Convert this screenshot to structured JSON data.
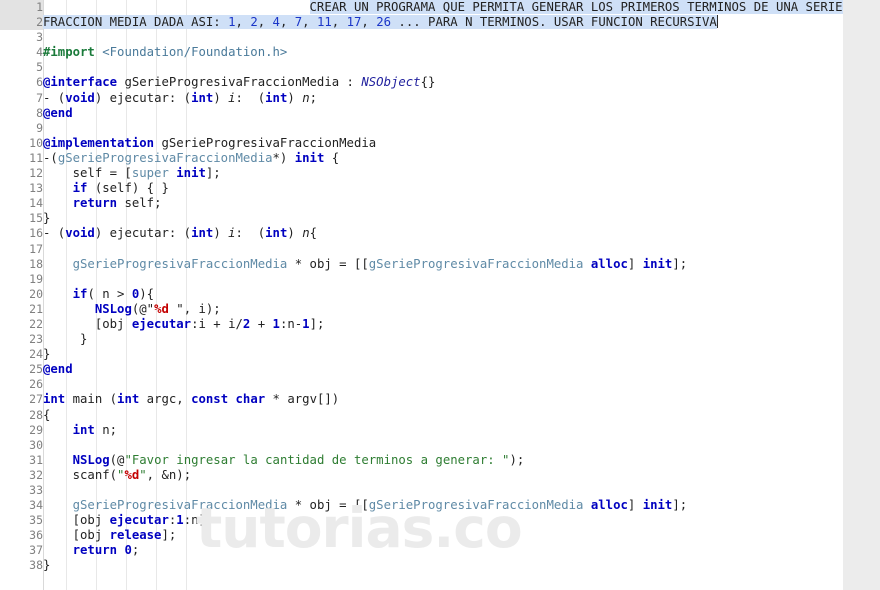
{
  "editor": {
    "language": "Objective-C",
    "watermark": "tutorias.co",
    "total_lines": 38,
    "selection_text_line1": "CREAR UN PROGRAMA QUE PERMITA GENERAR LOS PRIMEROS TERMINOS DE UNA SERIE PROGRESIVA",
    "selection_text_line2": "FRACCION MEDIA DADA ASI: 1, 2, 4, 7, 11, 17, 26 ... PARA N TERMINOS. USAR FUNCION RECURSIVA",
    "colors": {
      "background": "#ffffff",
      "gutter_text": "#808080",
      "gutter_selected_bg": "#e3e3e3",
      "selection_bg": "#cfe0f7",
      "keyword": "#0000c0",
      "preprocessor": "#1a7a3a",
      "class_name": "#5f8aa6",
      "string": "#2e7d32",
      "format_specifier": "#c40000",
      "number": "#0000c0",
      "scrollbar_track": "#ececec"
    }
  },
  "line_numbers": [
    1,
    2,
    3,
    4,
    5,
    6,
    7,
    8,
    9,
    10,
    11,
    12,
    13,
    14,
    15,
    16,
    17,
    18,
    19,
    20,
    21,
    22,
    23,
    24,
    25,
    26,
    27,
    28,
    29,
    30,
    31,
    32,
    33,
    34,
    35,
    36,
    37,
    38
  ],
  "code_lines": {
    "l1": "                                    CREAR UN PROGRAMA QUE PERMITA GENERAR LOS PRIMEROS TERMINOS DE UNA SERIE PROGRESIVA",
    "l2": "FRACCION MEDIA DADA ASI: 1, 2, 4, 7, 11, 17, 26 ... PARA N TERMINOS. USAR FUNCION RECURSIVA",
    "l3": "",
    "l4": "#import <Foundation/Foundation.h>",
    "l5": "",
    "l6": "@interface gSerieProgresivaFraccionMedia : NSObject{}",
    "l7": "- (void) ejecutar: (int) i:  (int) n;",
    "l8": "@end",
    "l9": "",
    "l10": "@implementation gSerieProgresivaFraccionMedia",
    "l11": "-(gSerieProgresivaFraccionMedia*) init {",
    "l12": "    self = [super init];",
    "l13": "    if (self) { }",
    "l14": "    return self;",
    "l15": "}",
    "l16": "- (void) ejecutar: (int) i:  (int) n{",
    "l17": "",
    "l18": "    gSerieProgresivaFraccionMedia * obj = [[gSerieProgresivaFraccionMedia alloc] init];",
    "l19": "",
    "l20": "    if( n > 0){",
    "l21": "       NSLog(@\"%d \", i);",
    "l22": "       [obj ejecutar:i + i/2 + 1:n-1];",
    "l23": "     }",
    "l24": "}",
    "l25": "@end",
    "l26": "",
    "l27": "int main (int argc, const char * argv[])",
    "l28": "{",
    "l29": "    int n;",
    "l30": "",
    "l31": "    NSLog(@\"Favor ingresar la cantidad de terminos a generar: \");",
    "l32": "    scanf(\"%d\", &n);",
    "l33": "",
    "l34": "    gSerieProgresivaFraccionMedia * obj = [[gSerieProgresivaFraccionMedia alloc] init];",
    "l35": "    [obj ejecutar:1:n];",
    "l36": "    [obj release];",
    "l37": "    return 0;",
    "l38": "}"
  },
  "tokens": {
    "sel1_text": "CREAR UN PROGRAMA QUE PERMITA GENERAR LOS PRIMEROS TERMINOS DE UNA SERIE PROGRESIVA",
    "sel2_a": "FRACCION MEDIA DADA ASI: ",
    "sel2_n1": "1",
    "sel2_c1": ", ",
    "sel2_n2": "2",
    "sel2_c2": ", ",
    "sel2_n3": "4",
    "sel2_c3": ", ",
    "sel2_n4": "7",
    "sel2_c4": ", ",
    "sel2_n5": "11",
    "sel2_c5": ", ",
    "sel2_n6": "17",
    "sel2_c6": ", ",
    "sel2_n7": "26",
    "sel2_b": " ... PARA N TERMINOS. USAR FUNCION RECURSIVA",
    "t4_import": "#import",
    "t4_header": " <Foundation/Foundation.h>",
    "t6_kw": "@interface",
    "t6_name": " gSerieProgresivaFraccionMedia : ",
    "t6_type": "NSObject",
    "t6_tail": "{}",
    "t7_dash": "- (",
    "t7_void": "void",
    "t7_mid": ") ejecutar: (",
    "t7_int1": "int",
    "t7_p1": ") ",
    "t7_i": "i",
    "t7_mid2": ":  (",
    "t7_int2": "int",
    "t7_p2": ") ",
    "t7_n": "n",
    "t7_end": ";",
    "t8_end": "@end",
    "t10_kw": "@implementation",
    "t10_name": " gSerieProgresivaFraccionMedia",
    "t11_a": "-(",
    "t11_cls": "gSerieProgresivaFraccionMedia",
    "t11_b": "*) ",
    "t11_init": "init",
    "t11_c": " {",
    "t12_a": "    self = [",
    "t12_super": "super",
    "t12_sp": " ",
    "t12_init": "init",
    "t12_b": "];",
    "t13_if": "    if",
    "t13_rest": " (self) { }",
    "t14_ret": "    return",
    "t14_rest": " self;",
    "t15": "}",
    "t16_dash": "- (",
    "t16_void": "void",
    "t16_mid": ") ejecutar: (",
    "t16_int1": "int",
    "t16_p1": ") ",
    "t16_i": "i",
    "t16_mid2": ":  (",
    "t16_int2": "int",
    "t16_p2": ") ",
    "t16_n": "n",
    "t16_end": "{",
    "t18_ind": "    ",
    "t18_cls1": "gSerieProgresivaFraccionMedia",
    "t18_mid": " * obj = [[",
    "t18_cls2": "gSerieProgresivaFraccionMedia",
    "t18_sp": " ",
    "t18_alloc": "alloc",
    "t18_br": "] ",
    "t18_init": "init",
    "t18_end": "];",
    "t20_ind": "    ",
    "t20_if": "if",
    "t20_a": "( n > ",
    "t20_zero": "0",
    "t20_b": "){",
    "t21_ind": "       ",
    "t21_nslog": "NSLog",
    "t21_a": "(@\"",
    "t21_fmt": "%d",
    "t21_b": " \", i);",
    "t22_ind": "       [obj ",
    "t22_msg": "ejecutar",
    "t22_a": ":i + i/",
    "t22_n2": "2",
    "t22_b": " + ",
    "t22_n1": "1",
    "t22_c": ":n-",
    "t22_n3": "1",
    "t22_d": "];",
    "t23": "     }",
    "t24": "}",
    "t25": "@end",
    "t27_int": "int",
    "t27_main": " main (",
    "t27_int2": "int",
    "t27_argc": " argc, ",
    "t27_const": "const",
    "t27_sp": " ",
    "t27_char": "char",
    "t27_rest": " * argv[])",
    "t28": "{",
    "t29_ind": "    ",
    "t29_int": "int",
    "t29_rest": " n;",
    "t31_ind": "    ",
    "t31_nslog": "NSLog",
    "t31_a": "(@",
    "t31_str": "\"Favor ingresar la cantidad de terminos a generar: \"",
    "t31_b": ");",
    "t32_ind": "    scanf(",
    "t32_q1": "\"",
    "t32_fmt": "%d",
    "t32_q2": "\"",
    "t32_b": ", &n);",
    "t34_ind": "    ",
    "t34_cls1": "gSerieProgresivaFraccionMedia",
    "t34_mid": " * obj = [[",
    "t34_cls2": "gSerieProgresivaFraccionMedia",
    "t34_sp": " ",
    "t34_alloc": "alloc",
    "t34_br": "] ",
    "t34_init": "init",
    "t34_end": "];",
    "t35_ind": "    [obj ",
    "t35_msg": "ejecutar",
    "t35_a": ":",
    "t35_n": "1",
    "t35_b": ":n];",
    "t36_ind": "    [obj ",
    "t36_msg": "release",
    "t36_b": "];",
    "t37_ind": "    ",
    "t37_ret": "return",
    "t37_sp": " ",
    "t37_zero": "0",
    "t37_end": ";",
    "t38": "}"
  }
}
